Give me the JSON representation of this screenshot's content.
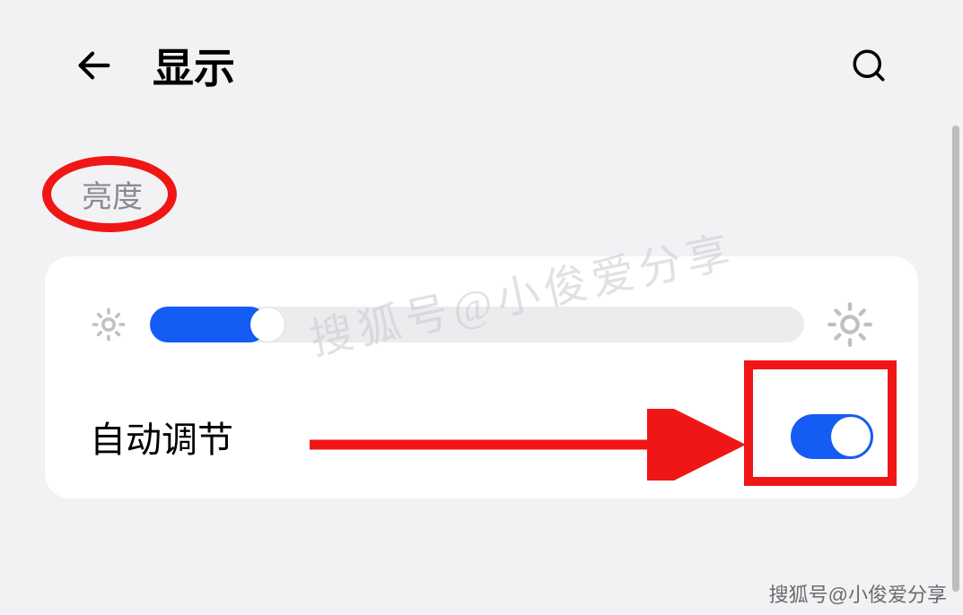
{
  "header": {
    "title": "显示"
  },
  "section": {
    "label": "亮度"
  },
  "slider": {
    "percent": 18
  },
  "auto": {
    "label": "自动调节",
    "enabled": true
  },
  "watermark": {
    "main": "搜狐号@小俊爱分享",
    "footer": "搜狐号@小俊爱分享"
  },
  "accent_color": "#155cf4",
  "annotation_color": "#f01616"
}
